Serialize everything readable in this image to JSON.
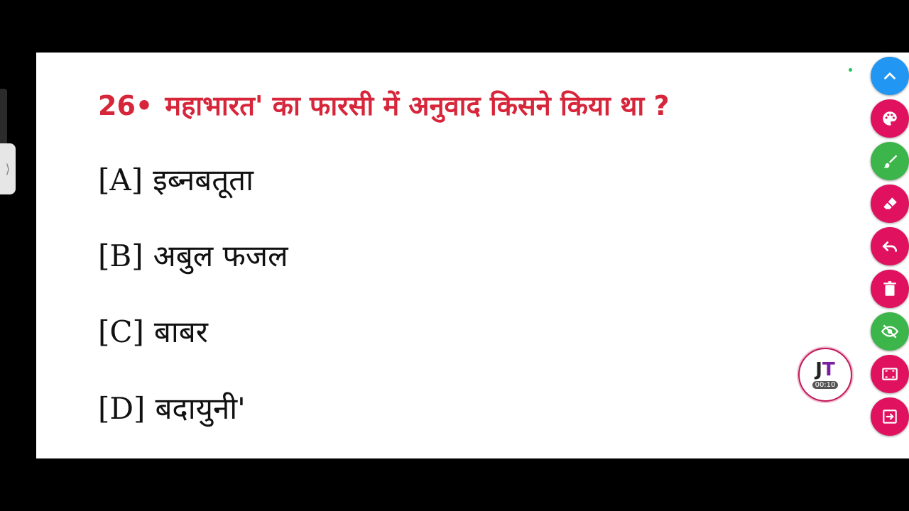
{
  "question": {
    "number": "26•",
    "text": "महाभारत' का फारसी में अनुवाद किसने किया था ?"
  },
  "options": [
    {
      "key": "[A]",
      "text": "इब्नबतूता"
    },
    {
      "key": "[B]",
      "text": "अबुल फजल"
    },
    {
      "key": "[C]",
      "text": "बाबर"
    },
    {
      "key": "[D]",
      "text": "बदायुनी'"
    }
  ],
  "timer": {
    "logo_j": "J",
    "logo_t": "T",
    "time": "00:10"
  },
  "toolbar": {
    "buttons": [
      {
        "icon": "chevron-up-icon",
        "color": "#2196f3"
      },
      {
        "icon": "palette-icon",
        "color": "#e0115f"
      },
      {
        "icon": "brush-icon",
        "color": "#3cb54a"
      },
      {
        "icon": "eraser-icon",
        "color": "#e0115f"
      },
      {
        "icon": "undo-icon",
        "color": "#e0115f"
      },
      {
        "icon": "trash-icon",
        "color": "#e0115f"
      },
      {
        "icon": "eye-off-icon",
        "color": "#3cb54a"
      },
      {
        "icon": "fullscreen-icon",
        "color": "#e0115f"
      },
      {
        "icon": "exit-icon",
        "color": "#e0115f"
      }
    ]
  },
  "colors": {
    "question": "#d7253a",
    "accent_pink": "#e0115f",
    "accent_green": "#3cb54a",
    "accent_blue": "#2196f3"
  }
}
